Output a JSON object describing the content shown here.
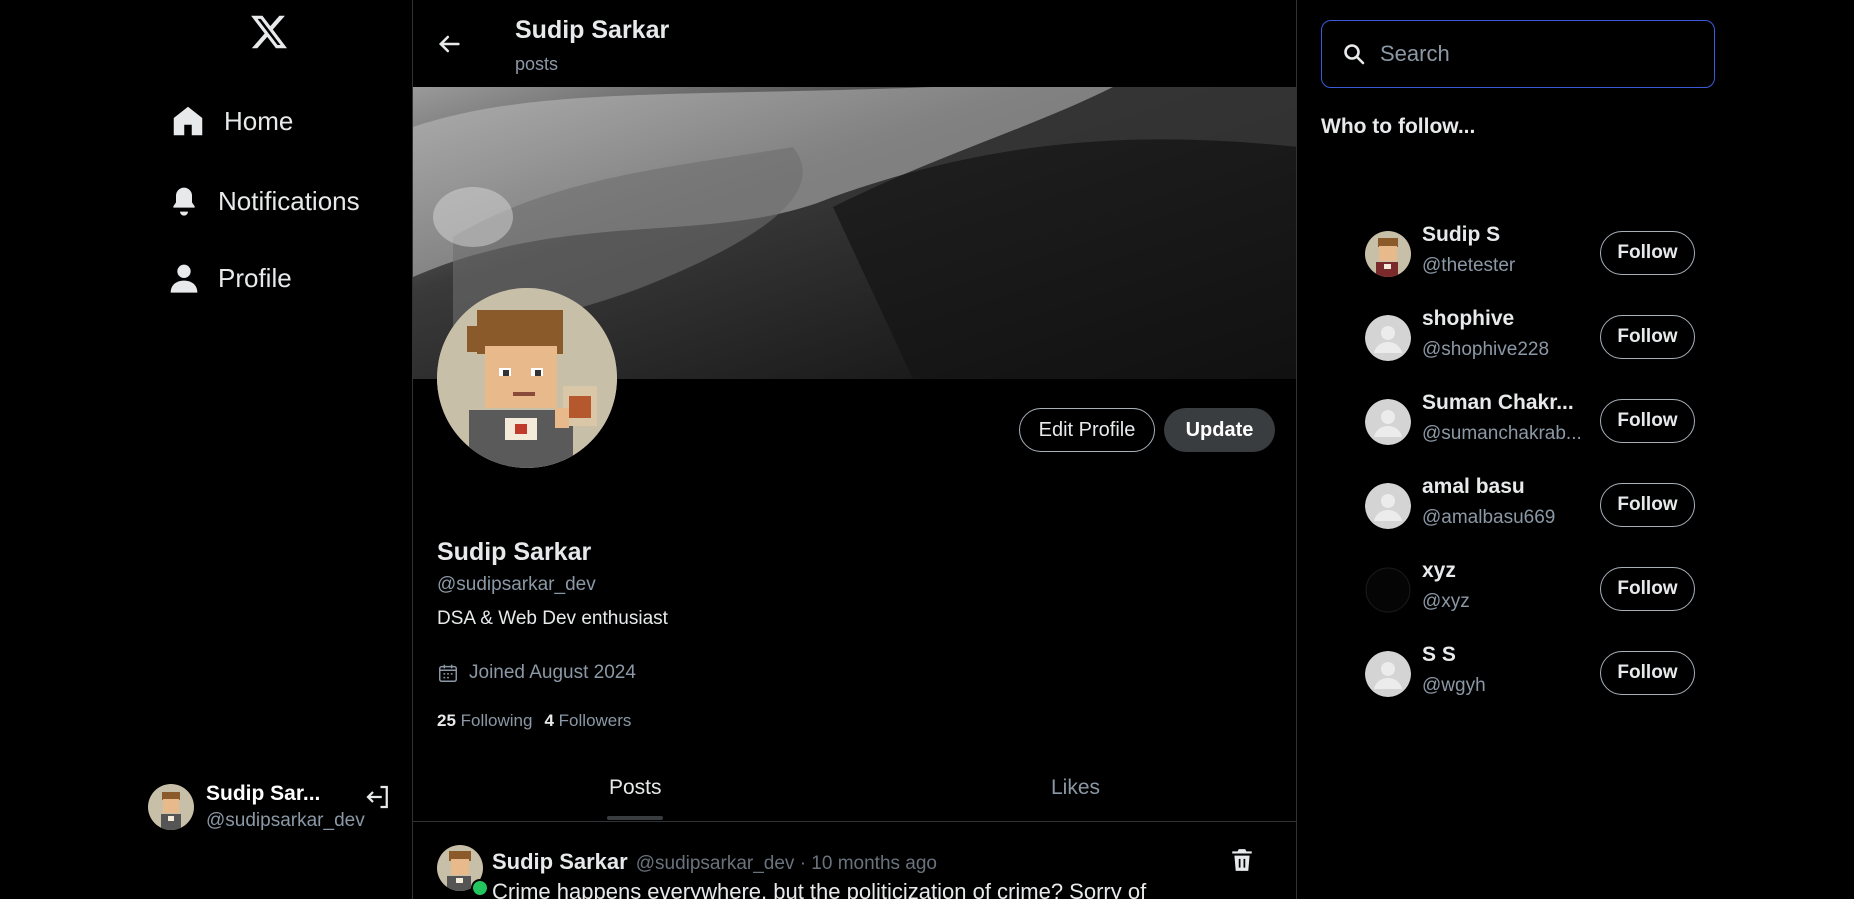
{
  "nav": {
    "logo": "x-logo-icon",
    "items": [
      {
        "label": "Home",
        "icon": "home-icon"
      },
      {
        "label": "Notifications",
        "icon": "bell-icon"
      },
      {
        "label": "Profile",
        "icon": "user-icon"
      }
    ]
  },
  "current_user": {
    "name": "Sudip Sar...",
    "handle": "@sudipsarkar_dev"
  },
  "header": {
    "title": "Sudip Sarkar",
    "subtitle": "posts"
  },
  "profile": {
    "name": "Sudip Sarkar",
    "handle": "@sudipsarkar_dev",
    "bio": "DSA & Web Dev enthusiast",
    "joined": "Joined August 2024",
    "following_count": "25",
    "following_label": "Following",
    "followers_count": "4",
    "followers_label": "Followers",
    "edit_label": "Edit Profile",
    "update_label": "Update"
  },
  "tabs": [
    {
      "label": "Posts",
      "active": true
    },
    {
      "label": "Likes",
      "active": false
    }
  ],
  "post": {
    "author": "Sudip Sarkar",
    "meta": "@sudipsarkar_dev · 10 months ago",
    "text": "Crime happens everywhere, but the politicization of crime? Sorry of"
  },
  "search": {
    "placeholder": "Search"
  },
  "who_to_follow": {
    "title": "Who to follow...",
    "follow_label": "Follow",
    "users": [
      {
        "name": "Sudip S",
        "handle": "@thetester",
        "avatar": "pixel"
      },
      {
        "name": "shophive",
        "handle": "@shophive228",
        "avatar": "default"
      },
      {
        "name": "Suman Chakr...",
        "handle": "@sumanchakrab...",
        "avatar": "default"
      },
      {
        "name": "amal basu",
        "handle": "@amalbasu669",
        "avatar": "default"
      },
      {
        "name": "xyz",
        "handle": "@xyz",
        "avatar": "dark"
      },
      {
        "name": "S S",
        "handle": "@wgyh",
        "avatar": "default"
      }
    ]
  },
  "colors": {
    "background": "#000000",
    "border": "#2f3336",
    "muted": "#8b98a5",
    "search_border": "#3b5bdb",
    "online": "#22c55e"
  }
}
